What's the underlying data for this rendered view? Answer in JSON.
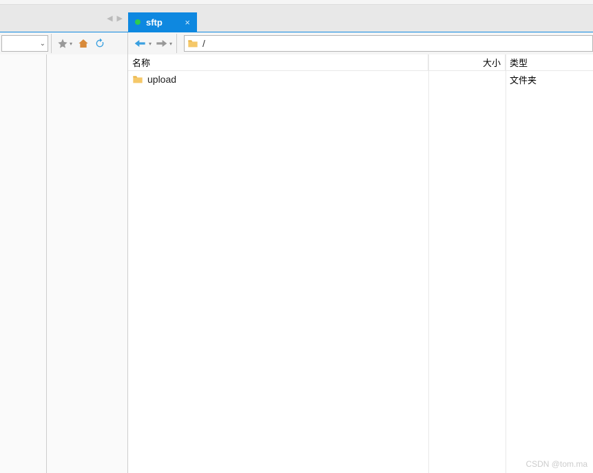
{
  "tab": {
    "label": "sftp"
  },
  "path": {
    "value": "/"
  },
  "columns": {
    "name": "名称",
    "size": "大小",
    "type": "类型"
  },
  "rows": [
    {
      "name": "upload",
      "size": "",
      "type": "文件夹"
    }
  ],
  "watermark": "CSDN @tom.ma"
}
